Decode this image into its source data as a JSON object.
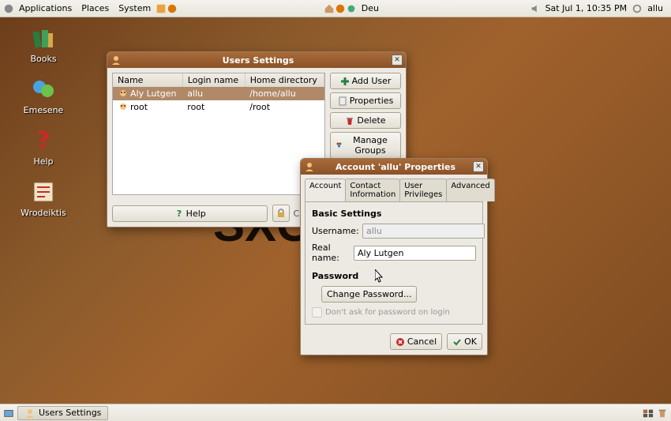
{
  "panel": {
    "menus": [
      "Applications",
      "Places",
      "System"
    ],
    "input_indicator": "Deu",
    "clock": "Sat Jul  1, 10:35 PM",
    "user": "allu"
  },
  "desktop": {
    "icons": [
      {
        "label": "Books"
      },
      {
        "label": "Emesene"
      },
      {
        "label": "Help"
      },
      {
        "label": "Wrodeiktis"
      }
    ],
    "watermark": "SXC"
  },
  "users_window": {
    "title": "Users Settings",
    "columns": [
      "Name",
      "Login name",
      "Home directory"
    ],
    "rows": [
      {
        "name": "Aly Lutgen",
        "login": "allu",
        "home": "/home/allu",
        "selected": true
      },
      {
        "name": "root",
        "login": "root",
        "home": "/root",
        "selected": false
      }
    ],
    "buttons": {
      "add": "Add User",
      "properties": "Properties",
      "delete": "Delete",
      "groups": "Manage Groups"
    },
    "help": "Help",
    "lock_text": "Click to prevent changes"
  },
  "account_window": {
    "title": "Account 'allu' Properties",
    "tabs": [
      "Account",
      "Contact Information",
      "User Privileges",
      "Advanced"
    ],
    "active_tab": 0,
    "basic_settings_label": "Basic Settings",
    "username_label": "Username:",
    "username_value": "allu",
    "realname_label": "Real name:",
    "realname_value": "Aly Lutgen",
    "password_label": "Password",
    "change_password_btn": "Change Password...",
    "dont_ask_label": "Don't ask for password on login",
    "cancel": "Cancel",
    "ok": "OK"
  },
  "taskbar": {
    "items": [
      "Users Settings"
    ]
  }
}
